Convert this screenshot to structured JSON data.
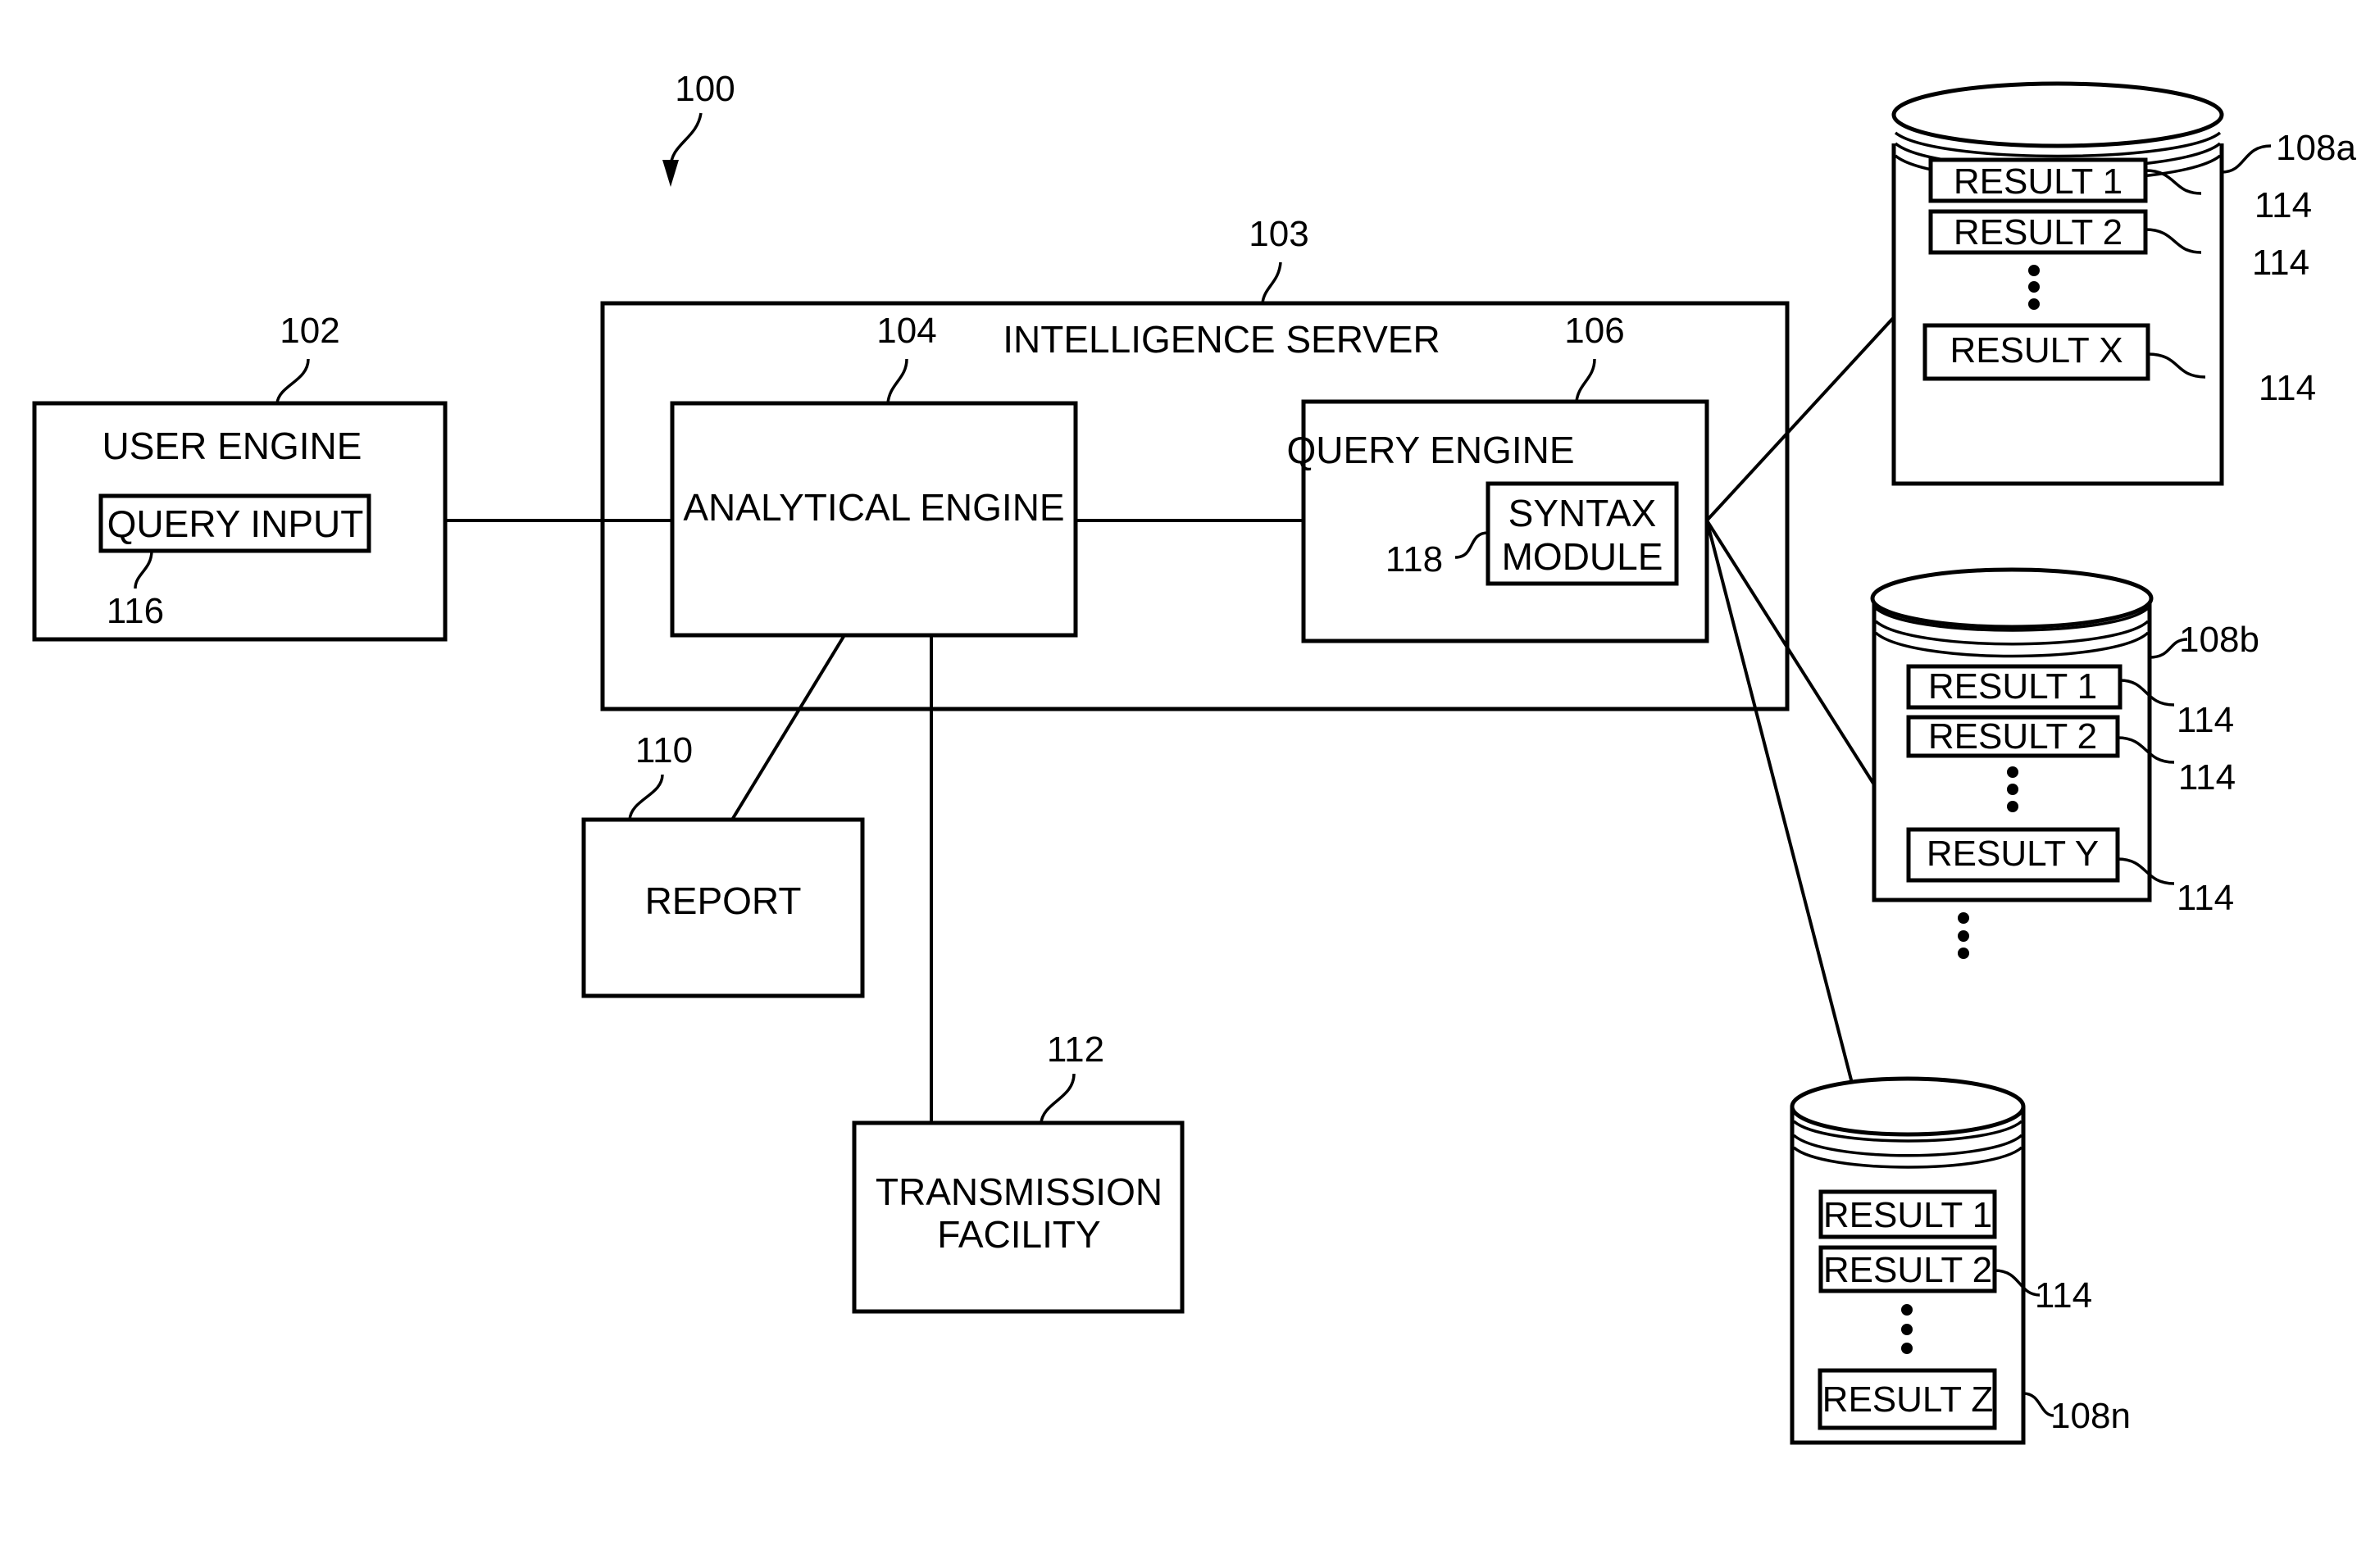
{
  "figure": {
    "ref": "100"
  },
  "user_engine": {
    "ref": "102",
    "label": "USER ENGINE",
    "query_input": {
      "ref": "116",
      "label": "QUERY INPUT"
    }
  },
  "server": {
    "ref": "103",
    "label": "INTELLIGENCE SERVER",
    "analytical_engine": {
      "ref": "104",
      "label": "ANALYTICAL ENGINE"
    },
    "query_engine": {
      "ref": "106",
      "label": "QUERY ENGINE",
      "syntax_module": {
        "ref": "118",
        "label_line1": "SYNTAX",
        "label_line2": "MODULE"
      }
    }
  },
  "report": {
    "ref": "110",
    "label": "REPORT"
  },
  "transmission": {
    "ref": "112",
    "label_line1": "TRANSMISSION",
    "label_line2": "FACILITY"
  },
  "databases": [
    {
      "ref": "108a",
      "results": [
        "RESULT 1",
        "RESULT 2",
        "RESULT X"
      ],
      "result_refs": [
        "114",
        "114",
        "114"
      ]
    },
    {
      "ref": "108b",
      "results": [
        "RESULT 1",
        "RESULT 2",
        "RESULT Y"
      ],
      "result_refs": [
        "114",
        "114",
        "114"
      ]
    },
    {
      "ref": "108n",
      "results": [
        "RESULT 1",
        "RESULT 2",
        "RESULT Z"
      ],
      "result_refs": [
        "114"
      ]
    }
  ]
}
